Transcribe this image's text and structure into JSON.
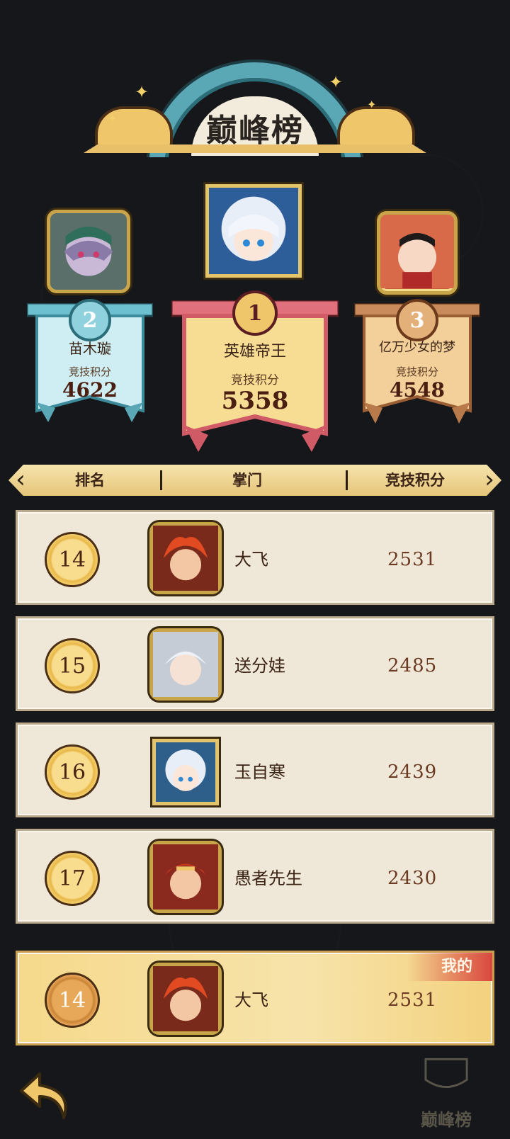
{
  "title": "巅峰榜",
  "podium": [
    {
      "rank": "2",
      "name": "苗木璇",
      "score_label": "竞技积分",
      "score": "4622"
    },
    {
      "rank": "1",
      "name": "英雄帝王",
      "score_label": "竞技积分",
      "score": "5358"
    },
    {
      "rank": "3",
      "name": "亿万少女的梦",
      "score_label": "竞技积分",
      "score": "4548"
    }
  ],
  "table_header": {
    "rank": "排名",
    "sect": "掌门",
    "score": "竞技积分",
    "prev": "‹",
    "next": "›"
  },
  "rows": [
    {
      "rank": "14",
      "name": "大飞",
      "score": "2531"
    },
    {
      "rank": "15",
      "name": "送分娃",
      "score": "2485"
    },
    {
      "rank": "16",
      "name": "玉自寒",
      "score": "2439"
    },
    {
      "rank": "17",
      "name": "愚者先生",
      "score": "2430"
    }
  ],
  "mine": {
    "tag": "我的",
    "rank": "14",
    "name": "大飞",
    "score": "2531"
  },
  "watermark": "巅峰榜",
  "colors": {
    "rank1": "#e0707c",
    "rank2": "#6cc0d0",
    "rank3": "#c98a5c",
    "gold": "#f0c66a",
    "bg": "#15171a"
  }
}
